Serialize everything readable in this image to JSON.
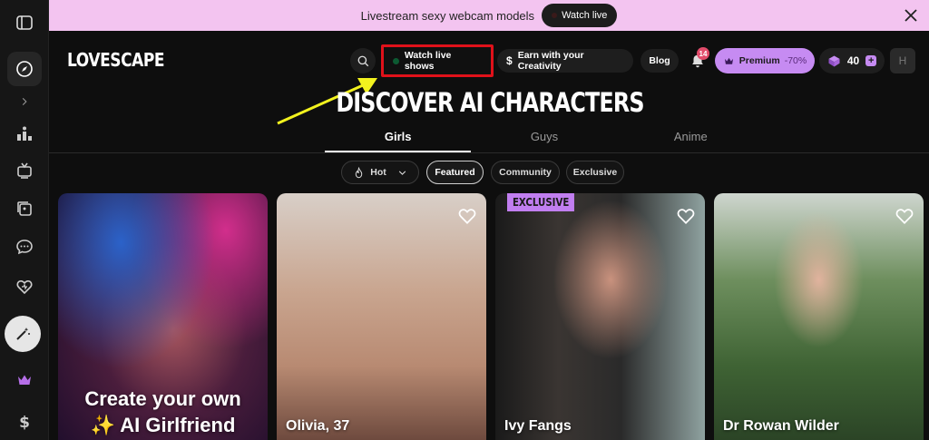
{
  "promo": {
    "text": "Livestream sexy webcam models",
    "button_label": "Watch live"
  },
  "sidebar": {
    "items": [
      {
        "icon": "panel-toggle-icon"
      },
      {
        "icon": "compass-icon",
        "active": true
      },
      {
        "icon": "chevron-right-icon"
      },
      {
        "icon": "leaderboard-icon"
      },
      {
        "icon": "tv-icon"
      },
      {
        "icon": "gallery-icon"
      },
      {
        "icon": "chat-icon"
      },
      {
        "icon": "heart-icon"
      },
      {
        "icon": "magic-wand-icon"
      },
      {
        "icon": "crown-icon"
      },
      {
        "icon": "dollar-icon"
      }
    ]
  },
  "header": {
    "logo": "LOVESCAPE",
    "watch_live": "Watch live shows",
    "earn": "Earn with your Creativity",
    "blog": "Blog",
    "notifications": "14",
    "premium": "Premium",
    "premium_discount": "-70%",
    "gems": "40",
    "avatar_initial": "H"
  },
  "main": {
    "title": "DISCOVER AI CHARACTERS",
    "tabs": [
      {
        "label": "Girls",
        "active": true
      },
      {
        "label": "Guys",
        "active": false
      },
      {
        "label": "Anime",
        "active": false
      }
    ],
    "filters": {
      "sort": "Hot",
      "chips": [
        "Featured",
        "Community",
        "Exclusive"
      ],
      "selected": "Featured"
    },
    "cards": [
      {
        "type": "create",
        "line1": "Create your own",
        "line2": "✨ AI Girlfriend"
      },
      {
        "name": "Olivia, 37"
      },
      {
        "name": "Ivy Fangs",
        "badge": "EXCLUSIVE"
      },
      {
        "name": "Dr Rowan Wilder"
      }
    ]
  },
  "colors": {
    "accent_purple": "#c68bf2",
    "promo_bg": "#f3c4f0",
    "highlight_red": "#e0111a",
    "arrow_yellow": "#f2f21e"
  }
}
